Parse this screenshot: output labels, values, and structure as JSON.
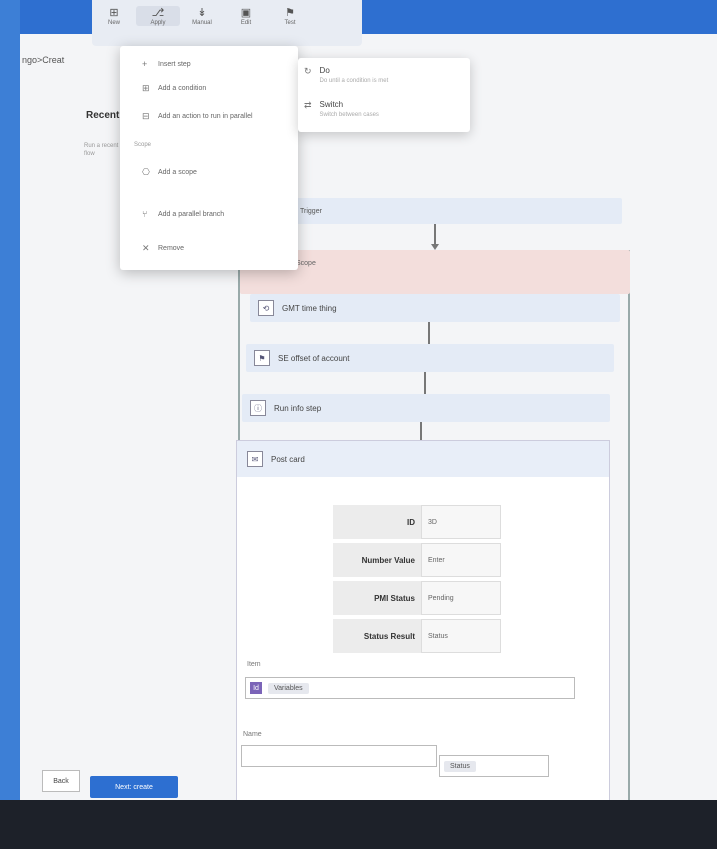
{
  "breadcrumb": "ngo>Creat",
  "ribbon": {
    "items": [
      {
        "label": "New",
        "icon": "new-icon"
      },
      {
        "label": "Apply",
        "icon": "apply-icon"
      },
      {
        "label": "Manual",
        "icon": "manual-icon"
      },
      {
        "label": "Edit",
        "icon": "edit-icon"
      },
      {
        "label": "Test",
        "icon": "test-icon"
      }
    ]
  },
  "panel": {
    "title": "Recent",
    "desc": "Run a recent flow"
  },
  "menu": {
    "items": [
      {
        "label": "Insert step"
      },
      {
        "label": "Add a condition"
      },
      {
        "label": "Add an action to run in parallel"
      }
    ],
    "section_label": "Scope",
    "section_items": [
      {
        "label": "Add a scope"
      },
      {
        "label": "Add a parallel branch"
      },
      {
        "label": "Remove"
      }
    ]
  },
  "submenu": {
    "items": [
      {
        "title": "Do",
        "desc": "Do until a condition is met"
      },
      {
        "title": "Switch",
        "desc": "Switch between cases"
      }
    ]
  },
  "flow": {
    "trigger_label": "Trigger",
    "scope_label": "Scope",
    "actions": [
      {
        "label": "GMT time thing"
      },
      {
        "label": "SE offset of account"
      },
      {
        "label": "Run info step"
      },
      {
        "label": "Post card"
      }
    ]
  },
  "card": {
    "params": [
      {
        "key": "ID",
        "value": "3D"
      },
      {
        "key": "Number Value",
        "value": "Enter"
      },
      {
        "key": "PMI Status",
        "value": "Pending"
      },
      {
        "key": "Status Result",
        "value": "Status"
      }
    ],
    "field1_label": "Item",
    "field1_token": "Id",
    "field1_chip": "Variables",
    "field2_label": "Name",
    "field2_chip": "Status"
  },
  "footer": {
    "back_label": "Back",
    "next_label": "Next: create"
  }
}
